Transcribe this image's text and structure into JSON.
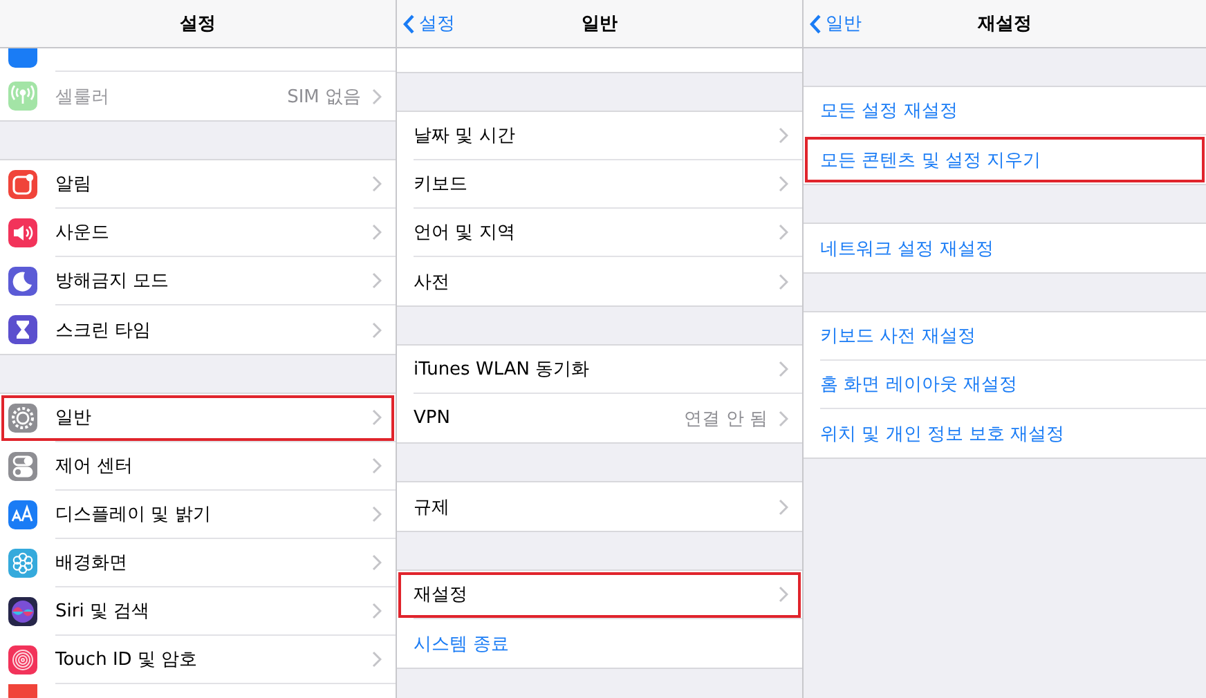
{
  "panels": [
    {
      "title": "설정",
      "sections": [
        {
          "rows": [
            {
              "kind": "partial",
              "color": "#1a7cf5"
            },
            {
              "kind": "nav",
              "label": "셀룰러",
              "value": "SIM 없음",
              "color": "#a3e4a6",
              "disabled": true,
              "highlighted": false
            }
          ]
        },
        {
          "rows": [
            {
              "kind": "nav",
              "label": "알림",
              "color": "#f0443a",
              "disabled": false,
              "highlighted": false
            },
            {
              "kind": "nav",
              "label": "사운드",
              "color": "#f2335a",
              "disabled": false,
              "highlighted": false
            },
            {
              "kind": "nav",
              "label": "방해금지 모드",
              "color": "#5b5bd6",
              "disabled": false,
              "highlighted": false
            },
            {
              "kind": "nav",
              "label": "스크린 타임",
              "color": "#5b4fce",
              "disabled": false,
              "highlighted": false
            }
          ]
        },
        {
          "rows": [
            {
              "kind": "nav",
              "label": "일반",
              "color": "#8e8e93",
              "disabled": false,
              "highlighted": true
            },
            {
              "kind": "nav",
              "label": "제어 센터",
              "color": "#8e8e93",
              "disabled": false,
              "highlighted": false
            },
            {
              "kind": "nav",
              "label": "디스플레이 및 밝기",
              "color": "#1a7cf5",
              "disabled": false,
              "highlighted": false
            },
            {
              "kind": "nav",
              "label": "배경화면",
              "color": "#35aadc",
              "disabled": false,
              "highlighted": false
            },
            {
              "kind": "nav",
              "label": "Siri 및 검색",
              "color": "#26264a",
              "disabled": false,
              "highlighted": false
            },
            {
              "kind": "nav",
              "label": "Touch ID 및 암호",
              "color": "#f2335a",
              "disabled": false,
              "highlighted": false
            },
            {
              "kind": "partial",
              "color": "#f0443a"
            }
          ]
        }
      ]
    },
    {
      "title": "일반",
      "back": "설정",
      "sections": [
        {
          "rows": [
            {
              "kind": "partial"
            }
          ]
        },
        {
          "rows": [
            {
              "kind": "nav",
              "label": "날짜 및 시간",
              "highlighted": false
            },
            {
              "kind": "nav",
              "label": "키보드",
              "highlighted": false
            },
            {
              "kind": "nav",
              "label": "언어 및 지역",
              "highlighted": false
            },
            {
              "kind": "nav",
              "label": "사전",
              "highlighted": false
            }
          ]
        },
        {
          "rows": [
            {
              "kind": "nav",
              "label": "iTunes WLAN 동기화",
              "highlighted": false
            },
            {
              "kind": "nav",
              "label": "VPN",
              "value": "연결 안 됨",
              "highlighted": false
            }
          ]
        },
        {
          "rows": [
            {
              "kind": "nav",
              "label": "규제",
              "highlighted": false
            }
          ]
        },
        {
          "rows": [
            {
              "kind": "nav",
              "label": "재설정",
              "highlighted": true
            },
            {
              "kind": "action",
              "label": "시스템 종료",
              "highlighted": false
            }
          ]
        }
      ]
    },
    {
      "title": "재설정",
      "back": "일반",
      "sections": [
        {
          "rows": [
            {
              "kind": "action",
              "label": "모든 설정 재설정",
              "highlighted": false
            },
            {
              "kind": "action",
              "label": "모든 콘텐츠 및 설정 지우기",
              "highlighted": true
            }
          ]
        },
        {
          "rows": [
            {
              "kind": "action",
              "label": "네트워크 설정 재설정",
              "highlighted": false
            }
          ]
        },
        {
          "rows": [
            {
              "kind": "action",
              "label": "키보드 사전 재설정",
              "highlighted": false
            },
            {
              "kind": "action",
              "label": "홈 화면 레이아웃 재설정",
              "highlighted": false
            },
            {
              "kind": "action",
              "label": "위치 및 개인 정보 보호 재설정",
              "highlighted": false
            }
          ]
        }
      ]
    }
  ]
}
